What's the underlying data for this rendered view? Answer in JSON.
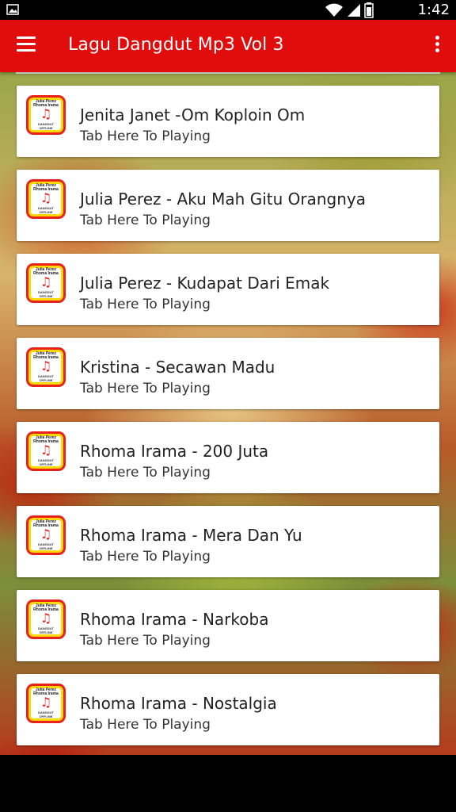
{
  "status_bar": {
    "time": "1:42",
    "icons": [
      "image-notification-icon",
      "wifi-icon",
      "signal-icon",
      "battery-icon"
    ]
  },
  "app_bar": {
    "title": "Lagu Dangdut Mp3 Vol 3",
    "color": "#e10d0d"
  },
  "app_icon": {
    "line1": "Julia Perez",
    "line2": "Rhoma Irama",
    "line3": "DANGDUT",
    "line4": "OFFLINE"
  },
  "songs": [
    {
      "title": "Jenita Janet -Om Koploin Om",
      "subtitle": "Tab Here To Playing"
    },
    {
      "title": "Julia Perez - Aku Mah Gitu Orangnya",
      "subtitle": "Tab Here To Playing"
    },
    {
      "title": "Julia Perez - Kudapat Dari Emak",
      "subtitle": "Tab Here To Playing"
    },
    {
      "title": "Kristina - Secawan Madu",
      "subtitle": "Tab Here To Playing"
    },
    {
      "title": "Rhoma Irama - 200 Juta",
      "subtitle": "Tab Here To Playing"
    },
    {
      "title": "Rhoma Irama - Mera Dan Yu",
      "subtitle": "Tab Here To Playing"
    },
    {
      "title": "Rhoma Irama - Narkoba",
      "subtitle": "Tab Here To Playing"
    },
    {
      "title": "Rhoma Irama - Nostalgia",
      "subtitle": "Tab Here To Playing"
    }
  ]
}
